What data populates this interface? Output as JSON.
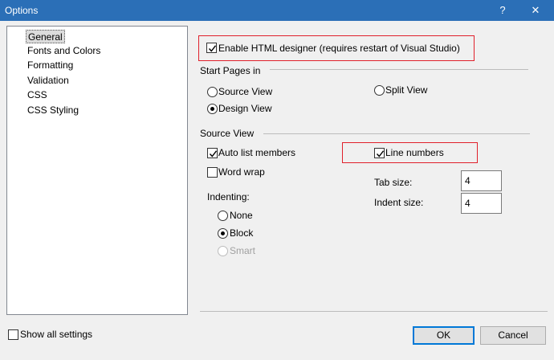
{
  "window": {
    "title": "Options",
    "help_glyph": "?",
    "close_glyph": "✕"
  },
  "tree": {
    "items": [
      {
        "label": "General",
        "selected": true
      },
      {
        "label": "Fonts and Colors"
      },
      {
        "label": "Formatting"
      },
      {
        "label": "Validation"
      },
      {
        "label": "CSS"
      },
      {
        "label": "CSS Styling"
      }
    ]
  },
  "designer": {
    "enable_label": "Enable HTML designer (requires restart of Visual Studio)",
    "checked": true
  },
  "start_pages": {
    "heading": "Start Pages in",
    "source_view": "Source View",
    "design_view": "Design View",
    "split_view": "Split View",
    "selected": "Design View"
  },
  "source_view": {
    "heading": "Source View",
    "auto_list": "Auto list members",
    "auto_list_checked": true,
    "word_wrap": "Word wrap",
    "word_wrap_checked": false,
    "line_numbers": "Line numbers",
    "line_numbers_checked": true,
    "tab_size_label": "Tab size:",
    "tab_size_value": "4",
    "indent_size_label": "Indent size:",
    "indent_size_value": "4"
  },
  "indenting": {
    "heading": "Indenting:",
    "none": "None",
    "block": "Block",
    "smart": "Smart",
    "selected": "Block"
  },
  "footer": {
    "show_all": "Show all settings",
    "ok": "OK",
    "cancel": "Cancel"
  },
  "colors": {
    "titlebar": "#2b6fb7",
    "highlight": "#e0202b",
    "default_button": "#0078d7"
  }
}
